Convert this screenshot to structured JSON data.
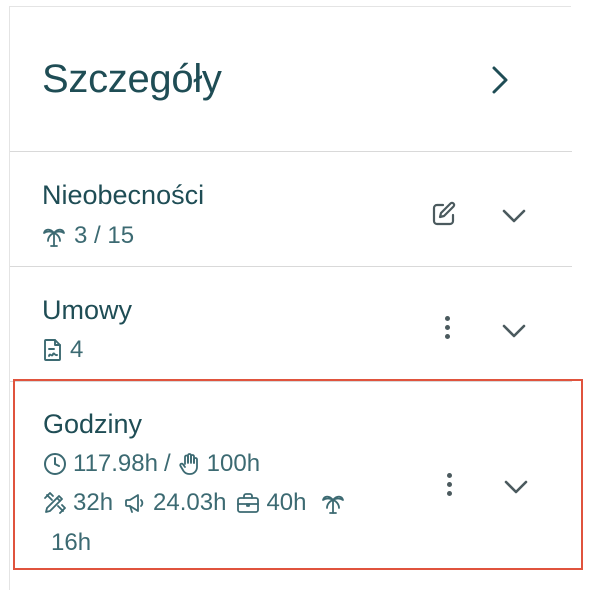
{
  "header": {
    "title": "Szczegóły"
  },
  "sections": {
    "absences": {
      "title": "Nieobecności",
      "count": "3 / 15"
    },
    "contracts": {
      "title": "Umowy",
      "count": "4"
    },
    "hours": {
      "title": "Godziny",
      "worked": "117.98h",
      "separator": "/",
      "planned": "100h",
      "item1": "32h",
      "item2": "24.03h",
      "item3": "40h",
      "item4": "16h"
    }
  },
  "colors": {
    "text": "#1f4d55",
    "highlight_border": "#e0533d",
    "divider": "#d9d9d9"
  },
  "icons": {
    "header": "chevron-right-icon",
    "absences": [
      "palm-tree-icon",
      "edit-icon",
      "chevron-down-icon"
    ],
    "contracts": [
      "document-icon",
      "more-vertical-icon",
      "chevron-down-icon"
    ],
    "hours": [
      "clock-icon",
      "hand-icon",
      "pencil-ruler-icon",
      "megaphone-icon",
      "briefcase-icon",
      "palm-tree-icon",
      "more-vertical-icon",
      "chevron-down-icon"
    ]
  }
}
